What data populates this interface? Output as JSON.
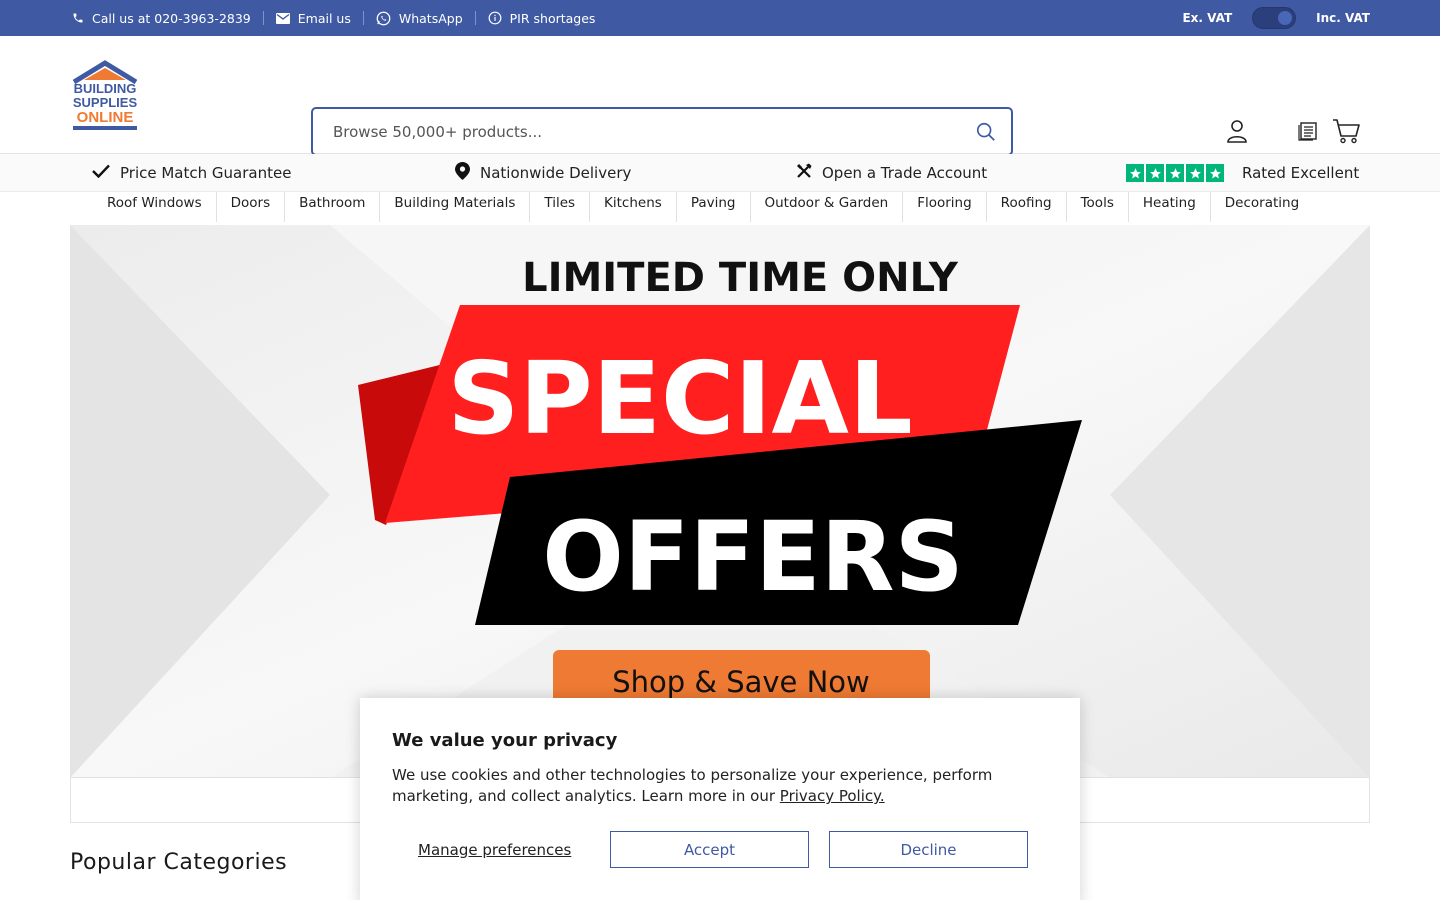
{
  "topbar": {
    "call_label": "Call us at 020-3963-2839",
    "email_label": "Email us",
    "whatsapp_label": "WhatsApp",
    "pir_label": "PIR shortages",
    "ex_vat": "Ex. VAT",
    "inc_vat": "Inc. VAT",
    "vat_toggle_on": "Inc. VAT"
  },
  "logo": {
    "line1": "BUILDING",
    "line2": "SUPPLIES",
    "line3": "ONLINE"
  },
  "search": {
    "placeholder": "Browse 50,000+ products..."
  },
  "nav": {
    "items": [
      "Roof Windows",
      "Doors",
      "Bathroom",
      "Building Materials",
      "Tiles",
      "Kitchens",
      "Paving",
      "Outdoor & Garden",
      "Flooring",
      "Roofing",
      "Tools",
      "Heating",
      "Decorating"
    ]
  },
  "usp": {
    "price_match": "Price Match Guarantee",
    "delivery": "Nationwide Delivery",
    "trade": "Open a Trade Account",
    "rated": "Rated Excellent",
    "rating_stars": 5
  },
  "hero": {
    "top_line": "LIMITED TIME ONLY",
    "word1": "SPECIAL",
    "word2": "OFFERS",
    "cta": "Shop & Save Now"
  },
  "popular": {
    "title": "Popular Categories"
  },
  "cookie": {
    "title": "We value your privacy",
    "body": "We use cookies and other technologies to personalize your experience, perform marketing, and collect analytics. Learn more in our ",
    "link": "Privacy Policy.",
    "manage": "Manage preferences",
    "accept": "Accept",
    "decline": "Decline"
  },
  "colors": {
    "brand_blue": "#3f5aa3",
    "offer_red": "#ff1f1f",
    "offer_black": "#000000",
    "cta_orange": "#ef7a33",
    "trustpilot_green": "#00b67a"
  }
}
